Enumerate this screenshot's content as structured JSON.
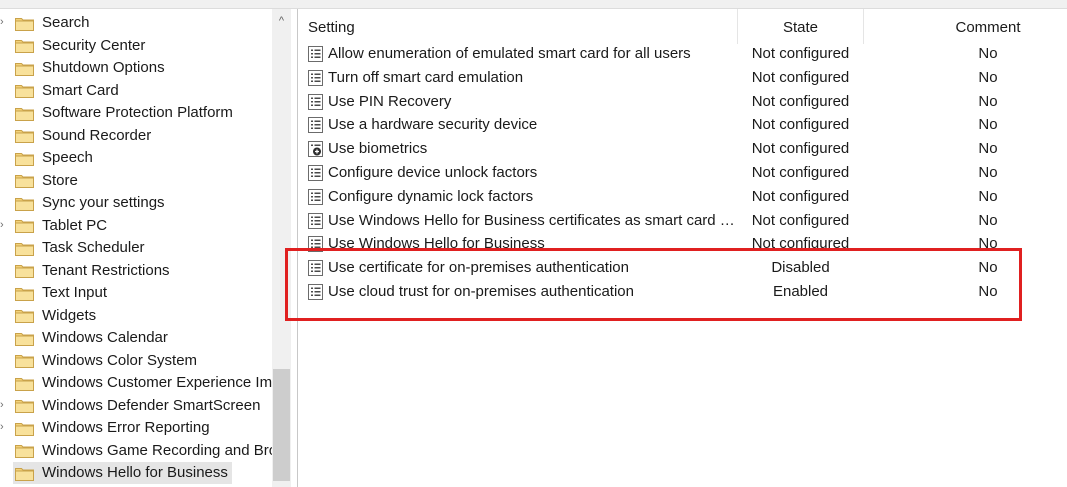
{
  "tree": {
    "items": [
      {
        "label": "Search",
        "expander": "›"
      },
      {
        "label": "Security Center",
        "expander": ""
      },
      {
        "label": "Shutdown Options",
        "expander": ""
      },
      {
        "label": "Smart Card",
        "expander": ""
      },
      {
        "label": "Software Protection Platform",
        "expander": ""
      },
      {
        "label": "Sound Recorder",
        "expander": ""
      },
      {
        "label": "Speech",
        "expander": ""
      },
      {
        "label": "Store",
        "expander": ""
      },
      {
        "label": "Sync your settings",
        "expander": ""
      },
      {
        "label": "Tablet PC",
        "expander": "›"
      },
      {
        "label": "Task Scheduler",
        "expander": ""
      },
      {
        "label": "Tenant Restrictions",
        "expander": ""
      },
      {
        "label": "Text Input",
        "expander": ""
      },
      {
        "label": "Widgets",
        "expander": ""
      },
      {
        "label": "Windows Calendar",
        "expander": ""
      },
      {
        "label": "Windows Color System",
        "expander": ""
      },
      {
        "label": "Windows Customer Experience Imp",
        "expander": ""
      },
      {
        "label": "Windows Defender SmartScreen",
        "expander": "›"
      },
      {
        "label": "Windows Error Reporting",
        "expander": "›"
      },
      {
        "label": "Windows Game Recording and Broa",
        "expander": ""
      },
      {
        "label": "Windows Hello for Business",
        "expander": "",
        "selected": true
      }
    ],
    "scroll_up_glyph": "^"
  },
  "list": {
    "columns": {
      "setting": "Setting",
      "state": "State",
      "comment": "Comment"
    },
    "rows": [
      {
        "name": "Allow enumeration of emulated smart card for all users",
        "state": "Not configured",
        "comment": "No",
        "icon": "policy-icon"
      },
      {
        "name": "Turn off smart card emulation",
        "state": "Not configured",
        "comment": "No",
        "icon": "policy-icon"
      },
      {
        "name": "Use PIN Recovery",
        "state": "Not configured",
        "comment": "No",
        "icon": "policy-icon"
      },
      {
        "name": "Use a hardware security device",
        "state": "Not configured",
        "comment": "No",
        "icon": "policy-icon"
      },
      {
        "name": "Use biometrics",
        "state": "Not configured",
        "comment": "No",
        "icon": "policy-folder-icon"
      },
      {
        "name": "Configure device unlock factors",
        "state": "Not configured",
        "comment": "No",
        "icon": "policy-icon"
      },
      {
        "name": "Configure dynamic lock factors",
        "state": "Not configured",
        "comment": "No",
        "icon": "policy-icon"
      },
      {
        "name": "Use Windows Hello for Business certificates as smart card cert…",
        "state": "Not configured",
        "comment": "No",
        "icon": "policy-icon"
      },
      {
        "name": "Use Windows Hello for Business",
        "state": "Not configured",
        "comment": "No",
        "icon": "policy-icon"
      },
      {
        "name": "Use certificate for on-premises authentication",
        "state": "Disabled",
        "comment": "No",
        "icon": "policy-icon"
      },
      {
        "name": "Use cloud trust for on-premises authentication",
        "state": "Enabled",
        "comment": "No",
        "icon": "policy-icon"
      }
    ]
  },
  "colors": {
    "highlight_border": "#e02020",
    "folder": "#f3d27a",
    "selection": "#e5e5e5"
  }
}
